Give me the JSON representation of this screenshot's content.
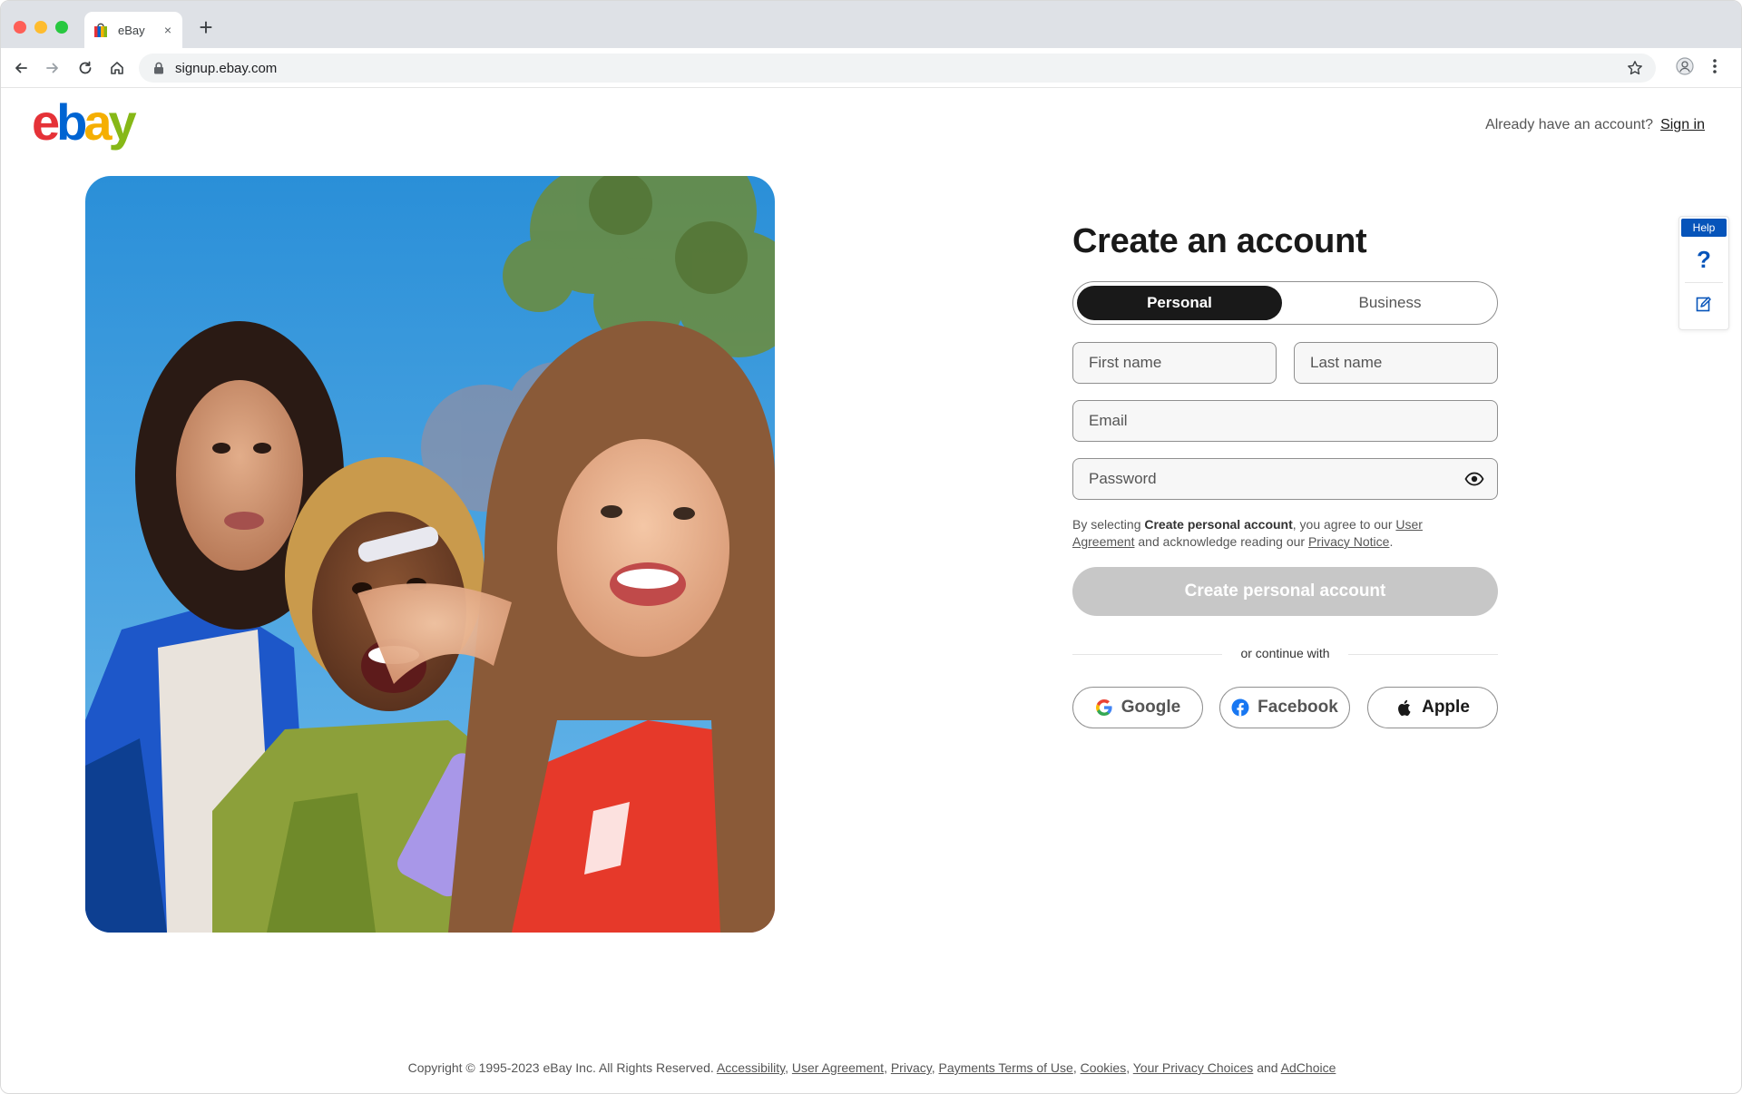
{
  "browser": {
    "tab_title": "eBay",
    "tab_close": "×",
    "new_tab": "+",
    "url": "signup.ebay.com"
  },
  "header": {
    "logo_letters": [
      "e",
      "b",
      "a",
      "y"
    ],
    "logo_colors": [
      "#e53238",
      "#0064d2",
      "#f5af02",
      "#86b817"
    ],
    "already_text": "Already have an account?",
    "sign_in_label": "Sign in"
  },
  "form": {
    "title": "Create an account",
    "tabs": [
      {
        "label": "Personal",
        "selected": true
      },
      {
        "label": "Business",
        "selected": false
      }
    ],
    "first_name_placeholder": "First name",
    "last_name_placeholder": "Last name",
    "email_placeholder": "Email",
    "password_placeholder": "Password",
    "legal": {
      "prefix": "By selecting",
      "bold": "Create personal account",
      "middle": ", you agree to our",
      "user_agreement_link": "User Agreement",
      "and_text": "and acknowledge reading our",
      "privacy_link": "Privacy Notice",
      "suffix": "."
    },
    "submit_label": "Create personal account",
    "divider_label": "or continue with",
    "social": [
      {
        "label": "Google"
      },
      {
        "label": "Facebook"
      },
      {
        "label": "Apple"
      }
    ]
  },
  "help": {
    "badge": "Help",
    "question": "?"
  },
  "footer": {
    "copyright": "Copyright © 1995-2023 eBay Inc. All Rights Reserved.",
    "links": [
      "Accessibility",
      "User Agreement",
      "Privacy",
      "Payments Terms of Use",
      "Cookies",
      "Your Privacy Choices",
      "AdChoice"
    ],
    "and_text": "and"
  },
  "colors": {
    "accent_blue": "#0654ba",
    "dark_button": "#191919",
    "disabled_button": "#c7c7c7"
  }
}
